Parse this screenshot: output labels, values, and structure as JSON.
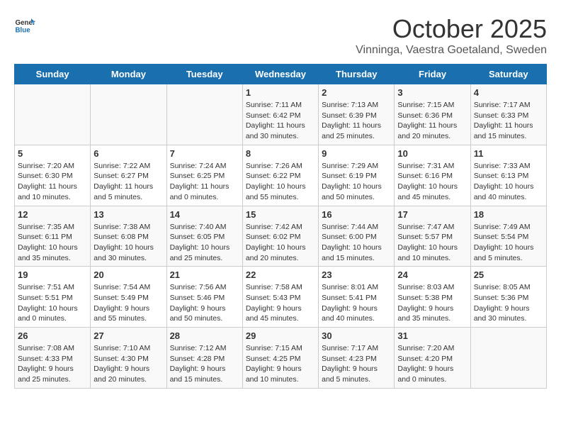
{
  "header": {
    "logo_general": "General",
    "logo_blue": "Blue",
    "month_title": "October 2025",
    "location": "Vinninga, Vaestra Goetaland, Sweden"
  },
  "weekdays": [
    "Sunday",
    "Monday",
    "Tuesday",
    "Wednesday",
    "Thursday",
    "Friday",
    "Saturday"
  ],
  "weeks": [
    [
      {
        "day": "",
        "info": ""
      },
      {
        "day": "",
        "info": ""
      },
      {
        "day": "",
        "info": ""
      },
      {
        "day": "1",
        "info": "Sunrise: 7:11 AM\nSunset: 6:42 PM\nDaylight: 11 hours\nand 30 minutes."
      },
      {
        "day": "2",
        "info": "Sunrise: 7:13 AM\nSunset: 6:39 PM\nDaylight: 11 hours\nand 25 minutes."
      },
      {
        "day": "3",
        "info": "Sunrise: 7:15 AM\nSunset: 6:36 PM\nDaylight: 11 hours\nand 20 minutes."
      },
      {
        "day": "4",
        "info": "Sunrise: 7:17 AM\nSunset: 6:33 PM\nDaylight: 11 hours\nand 15 minutes."
      }
    ],
    [
      {
        "day": "5",
        "info": "Sunrise: 7:20 AM\nSunset: 6:30 PM\nDaylight: 11 hours\nand 10 minutes."
      },
      {
        "day": "6",
        "info": "Sunrise: 7:22 AM\nSunset: 6:27 PM\nDaylight: 11 hours\nand 5 minutes."
      },
      {
        "day": "7",
        "info": "Sunrise: 7:24 AM\nSunset: 6:25 PM\nDaylight: 11 hours\nand 0 minutes."
      },
      {
        "day": "8",
        "info": "Sunrise: 7:26 AM\nSunset: 6:22 PM\nDaylight: 10 hours\nand 55 minutes."
      },
      {
        "day": "9",
        "info": "Sunrise: 7:29 AM\nSunset: 6:19 PM\nDaylight: 10 hours\nand 50 minutes."
      },
      {
        "day": "10",
        "info": "Sunrise: 7:31 AM\nSunset: 6:16 PM\nDaylight: 10 hours\nand 45 minutes."
      },
      {
        "day": "11",
        "info": "Sunrise: 7:33 AM\nSunset: 6:13 PM\nDaylight: 10 hours\nand 40 minutes."
      }
    ],
    [
      {
        "day": "12",
        "info": "Sunrise: 7:35 AM\nSunset: 6:11 PM\nDaylight: 10 hours\nand 35 minutes."
      },
      {
        "day": "13",
        "info": "Sunrise: 7:38 AM\nSunset: 6:08 PM\nDaylight: 10 hours\nand 30 minutes."
      },
      {
        "day": "14",
        "info": "Sunrise: 7:40 AM\nSunset: 6:05 PM\nDaylight: 10 hours\nand 25 minutes."
      },
      {
        "day": "15",
        "info": "Sunrise: 7:42 AM\nSunset: 6:02 PM\nDaylight: 10 hours\nand 20 minutes."
      },
      {
        "day": "16",
        "info": "Sunrise: 7:44 AM\nSunset: 6:00 PM\nDaylight: 10 hours\nand 15 minutes."
      },
      {
        "day": "17",
        "info": "Sunrise: 7:47 AM\nSunset: 5:57 PM\nDaylight: 10 hours\nand 10 minutes."
      },
      {
        "day": "18",
        "info": "Sunrise: 7:49 AM\nSunset: 5:54 PM\nDaylight: 10 hours\nand 5 minutes."
      }
    ],
    [
      {
        "day": "19",
        "info": "Sunrise: 7:51 AM\nSunset: 5:51 PM\nDaylight: 10 hours\nand 0 minutes."
      },
      {
        "day": "20",
        "info": "Sunrise: 7:54 AM\nSunset: 5:49 PM\nDaylight: 9 hours\nand 55 minutes."
      },
      {
        "day": "21",
        "info": "Sunrise: 7:56 AM\nSunset: 5:46 PM\nDaylight: 9 hours\nand 50 minutes."
      },
      {
        "day": "22",
        "info": "Sunrise: 7:58 AM\nSunset: 5:43 PM\nDaylight: 9 hours\nand 45 minutes."
      },
      {
        "day": "23",
        "info": "Sunrise: 8:01 AM\nSunset: 5:41 PM\nDaylight: 9 hours\nand 40 minutes."
      },
      {
        "day": "24",
        "info": "Sunrise: 8:03 AM\nSunset: 5:38 PM\nDaylight: 9 hours\nand 35 minutes."
      },
      {
        "day": "25",
        "info": "Sunrise: 8:05 AM\nSunset: 5:36 PM\nDaylight: 9 hours\nand 30 minutes."
      }
    ],
    [
      {
        "day": "26",
        "info": "Sunrise: 7:08 AM\nSunset: 4:33 PM\nDaylight: 9 hours\nand 25 minutes."
      },
      {
        "day": "27",
        "info": "Sunrise: 7:10 AM\nSunset: 4:30 PM\nDaylight: 9 hours\nand 20 minutes."
      },
      {
        "day": "28",
        "info": "Sunrise: 7:12 AM\nSunset: 4:28 PM\nDaylight: 9 hours\nand 15 minutes."
      },
      {
        "day": "29",
        "info": "Sunrise: 7:15 AM\nSunset: 4:25 PM\nDaylight: 9 hours\nand 10 minutes."
      },
      {
        "day": "30",
        "info": "Sunrise: 7:17 AM\nSunset: 4:23 PM\nDaylight: 9 hours\nand 5 minutes."
      },
      {
        "day": "31",
        "info": "Sunrise: 7:20 AM\nSunset: 4:20 PM\nDaylight: 9 hours\nand 0 minutes."
      },
      {
        "day": "",
        "info": ""
      }
    ]
  ]
}
